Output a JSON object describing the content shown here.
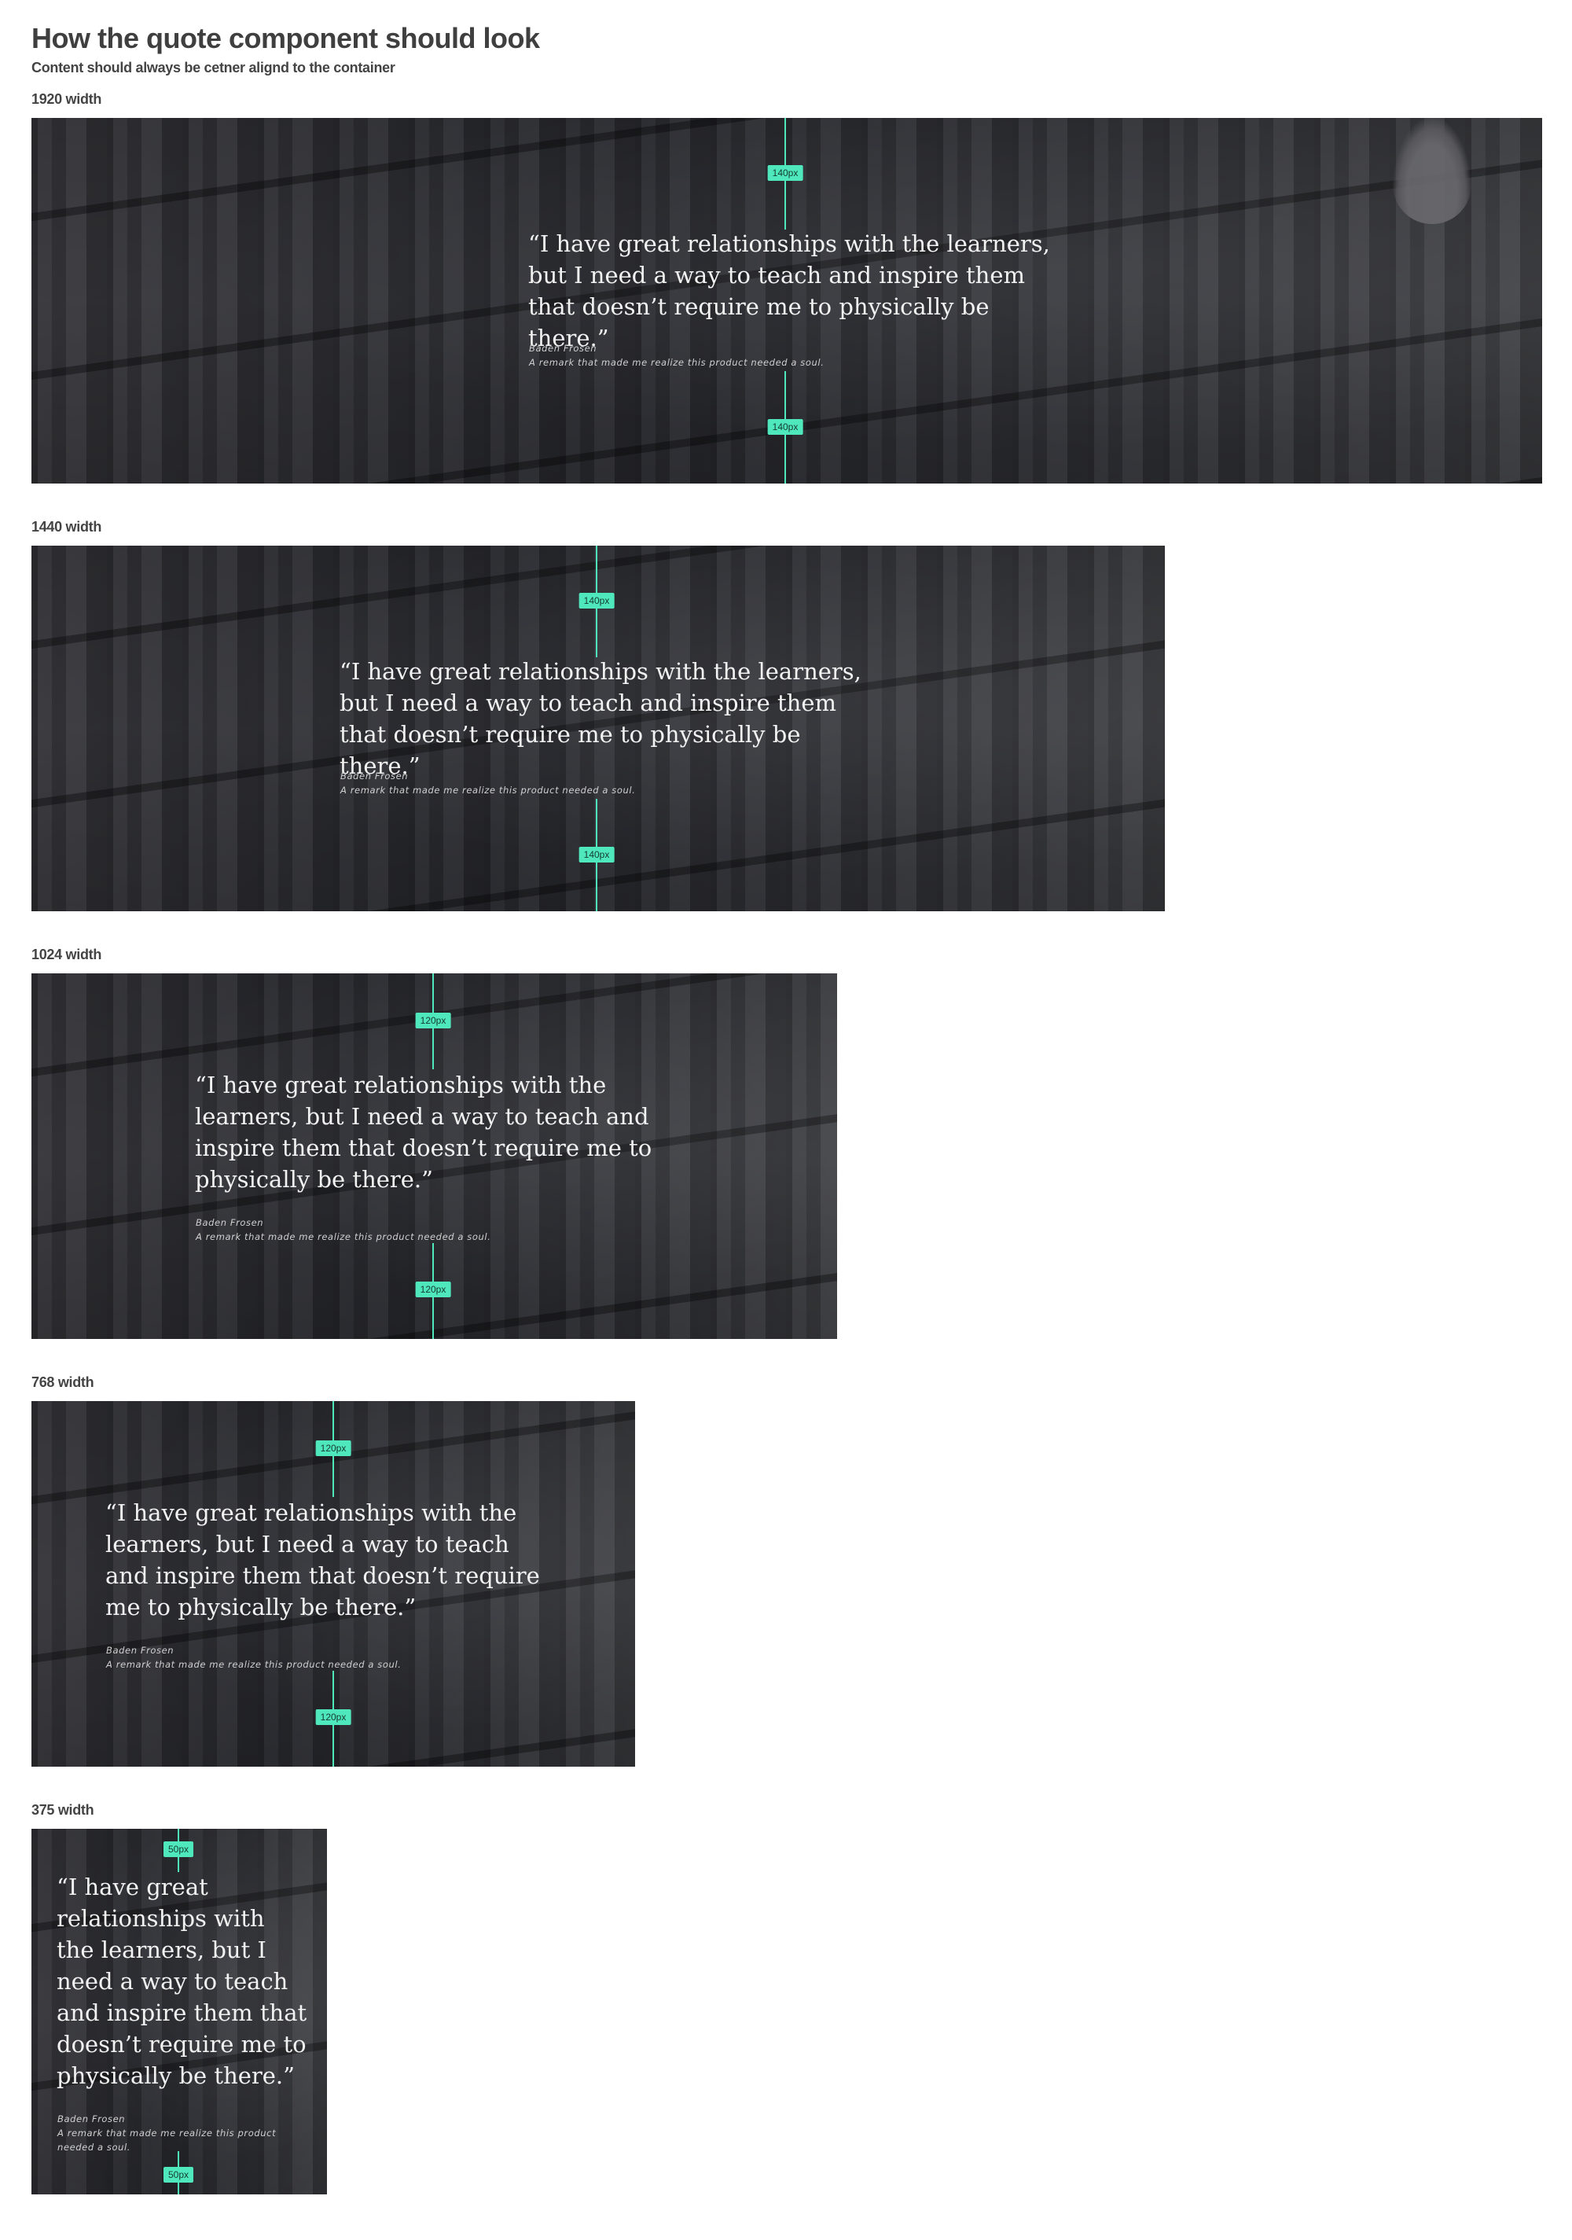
{
  "page": {
    "title": "How the quote component should look",
    "subtitle": "Content should always be cetner alignd to the container"
  },
  "quote": {
    "text": "“I have great relationships with the learners, but I need a way to teach and inspire them that doesn’t require me to physically be there.”",
    "author": "Baden Frosen",
    "caption": "A remark that made me realize this product needed a soul."
  },
  "accent_color": "#4fe8bc",
  "variants": [
    {
      "label": "1920 width",
      "top_spacing": "140px",
      "bottom_spacing": "140px"
    },
    {
      "label": "1440 width",
      "top_spacing": "140px",
      "bottom_spacing": "140px"
    },
    {
      "label": "1024 width",
      "top_spacing": "120px",
      "bottom_spacing": "120px"
    },
    {
      "label": "768 width",
      "top_spacing": "120px",
      "bottom_spacing": "120px"
    },
    {
      "label": "375 width",
      "top_spacing": "50px",
      "bottom_spacing": "50px"
    }
  ]
}
